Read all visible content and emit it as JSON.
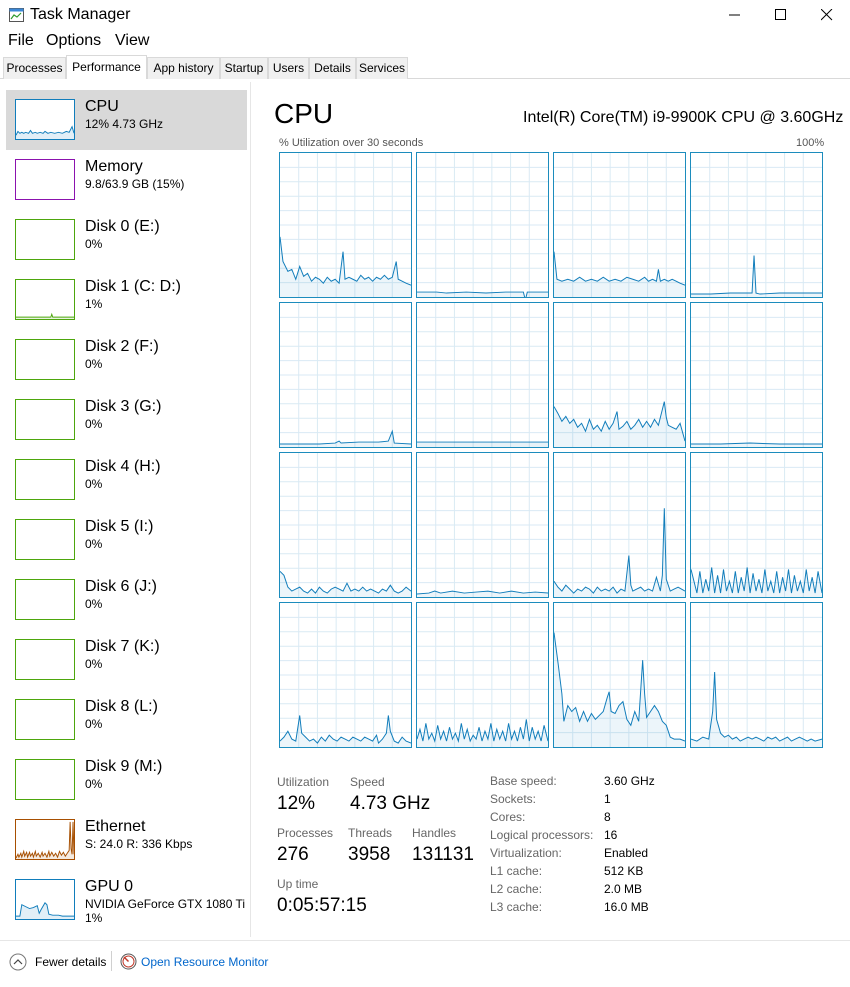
{
  "window": {
    "title": "Task Manager"
  },
  "menu": {
    "file": "File",
    "options": "Options",
    "view": "View"
  },
  "tabs": [
    "Processes",
    "Performance",
    "App history",
    "Startup",
    "Users",
    "Details",
    "Services"
  ],
  "sidebar": {
    "items": [
      {
        "title": "CPU",
        "sub": "12%  4.73 GHz",
        "color": "#117dbb"
      },
      {
        "title": "Memory",
        "sub": "9.8/63.9 GB (15%)",
        "color": "#8b12ae"
      },
      {
        "title": "Disk 0 (E:)",
        "sub": "0%",
        "color": "#4da60c"
      },
      {
        "title": "Disk 1 (C: D:)",
        "sub": "1%",
        "color": "#4da60c"
      },
      {
        "title": "Disk 2 (F:)",
        "sub": "0%",
        "color": "#4da60c"
      },
      {
        "title": "Disk 3 (G:)",
        "sub": "0%",
        "color": "#4da60c"
      },
      {
        "title": "Disk 4 (H:)",
        "sub": "0%",
        "color": "#4da60c"
      },
      {
        "title": "Disk 5 (I:)",
        "sub": "0%",
        "color": "#4da60c"
      },
      {
        "title": "Disk 6 (J:)",
        "sub": "0%",
        "color": "#4da60c"
      },
      {
        "title": "Disk 7 (K:)",
        "sub": "0%",
        "color": "#4da60c"
      },
      {
        "title": "Disk 8 (L:)",
        "sub": "0%",
        "color": "#4da60c"
      },
      {
        "title": "Disk 9 (M:)",
        "sub": "0%",
        "color": "#4da60c"
      },
      {
        "title": "Ethernet",
        "sub": "S: 24.0  R: 336 Kbps",
        "color": "#a74f01"
      },
      {
        "title": "GPU 0",
        "sub": "NVIDIA GeForce GTX 1080 Ti",
        "sub2": "1%",
        "color": "#117dbb"
      }
    ]
  },
  "cpu": {
    "title": "CPU",
    "model": "Intel(R) Core(TM) i9-9900K CPU @ 3.60GHz",
    "graph_label": "% Utilization over 30 seconds",
    "graph_max": "100%",
    "accent": "#117dbb"
  },
  "stats": {
    "utilization_label": "Utilization",
    "utilization": "12%",
    "speed_label": "Speed",
    "speed": "4.73 GHz",
    "processes_label": "Processes",
    "processes": "276",
    "threads_label": "Threads",
    "threads": "3958",
    "handles_label": "Handles",
    "handles": "131131",
    "uptime_label": "Up time",
    "uptime": "0:05:57:15"
  },
  "specs": [
    {
      "label": "Base speed:",
      "value": "3.60 GHz"
    },
    {
      "label": "Sockets:",
      "value": "1"
    },
    {
      "label": "Cores:",
      "value": "8"
    },
    {
      "label": "Logical processors:",
      "value": "16"
    },
    {
      "label": "Virtualization:",
      "value": "Enabled"
    },
    {
      "label": "L1 cache:",
      "value": "512 KB"
    },
    {
      "label": "L2 cache:",
      "value": "2.0 MB"
    },
    {
      "label": "L3 cache:",
      "value": "16.0 MB"
    }
  ],
  "footer": {
    "fewer_details": "Fewer details",
    "resource_monitor": "Open Resource Monitor"
  }
}
